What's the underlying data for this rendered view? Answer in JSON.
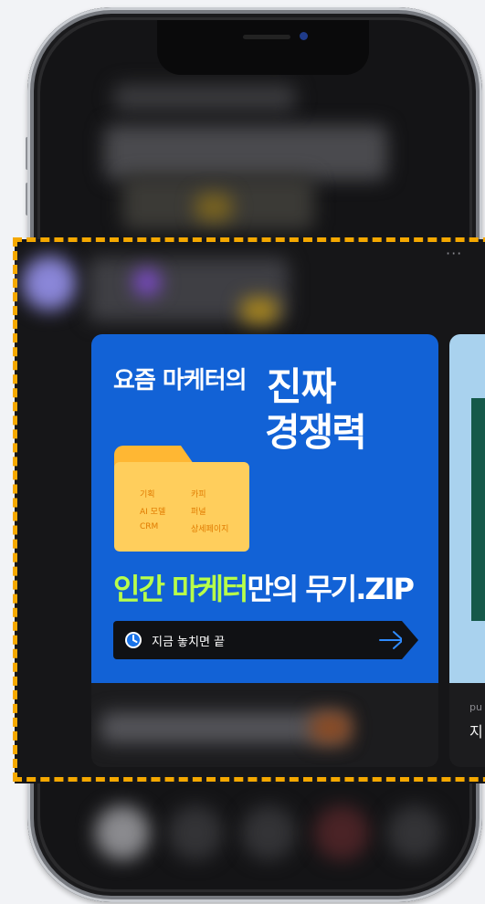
{
  "overlay": {
    "more_glyph": "···"
  },
  "card": {
    "banner": {
      "line1_small": "요즘 마케터의",
      "line1_big": "진짜",
      "line2_big": "경쟁력",
      "folder_tags": [
        "기획",
        "카피",
        "AI 모델",
        "퍼널",
        "CRM",
        "상세페이지"
      ],
      "line3_green": "인간 마케터",
      "line3_rest": "만의 무기.ZIP",
      "cta_label": "지금 놓치면 끝"
    }
  },
  "card2": {
    "meta": "pu",
    "title": "지"
  },
  "colors": {
    "accent_blue": "#1262d6",
    "highlight_green": "#b8ff4a",
    "dashed_border": "#f5a800",
    "folder": "#ffce5c"
  },
  "icons": [
    "more-icon",
    "clock-icon",
    "arrow-right-icon",
    "folder-icon"
  ]
}
